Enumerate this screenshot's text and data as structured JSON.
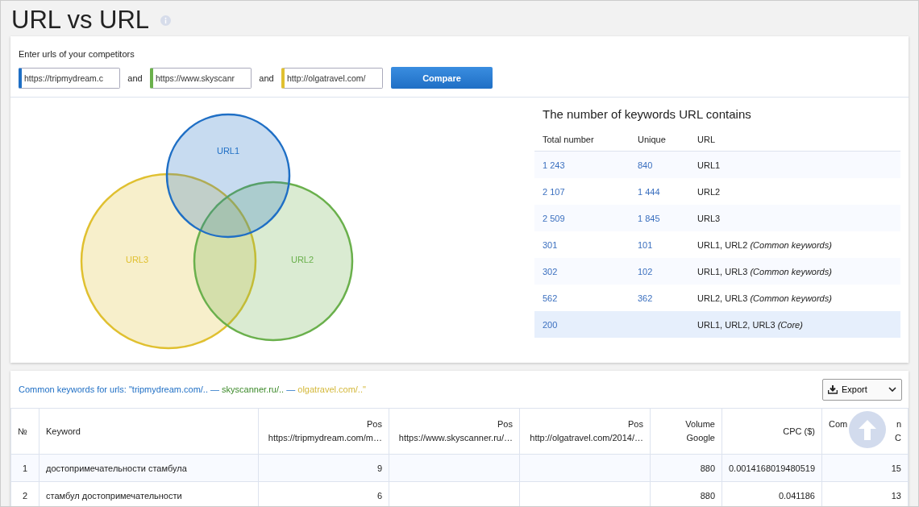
{
  "title": "URL vs URL",
  "form": {
    "label": "Enter urls of your competitors",
    "fields": [
      {
        "value": "https://tripmydream.c",
        "color": "#1f6fc5"
      },
      {
        "value": "https://www.skyscanr",
        "color": "#6ab04c"
      },
      {
        "value": "http://olgatravel.com/",
        "color": "#e0c030"
      }
    ],
    "separators": [
      "and",
      "and"
    ],
    "button": "Compare"
  },
  "venn": {
    "circles": [
      {
        "label": "URL1",
        "color": "#1f6fc5"
      },
      {
        "label": "URL2",
        "color": "#6ab04c"
      },
      {
        "label": "URL3",
        "color": "#e0c030"
      }
    ]
  },
  "stats": {
    "title": "The number of keywords URL contains",
    "columns": [
      "Total number",
      "Unique",
      "URL"
    ],
    "rows": [
      {
        "total": "1 243",
        "unique": "840",
        "url": "URL1",
        "selected": false
      },
      {
        "total": "2 107",
        "unique": "1 444",
        "url": "URL2",
        "selected": false
      },
      {
        "total": "2 509",
        "unique": "1 845",
        "url": "URL3",
        "selected": false
      },
      {
        "total": "301",
        "unique": "101",
        "url": "URL1, URL2 *(Common keywords)*",
        "selected": false
      },
      {
        "total": "302",
        "unique": "102",
        "url": "URL1, URL3 *(Common keywords)*",
        "selected": false
      },
      {
        "total": "562",
        "unique": "362",
        "url": "URL2, URL3 *(Common keywords)*",
        "selected": false
      },
      {
        "total": "200",
        "url": "URL1, URL2, URL3 *(Core)*",
        "selected": true
      }
    ]
  },
  "keywords": {
    "caption": [
      {
        "text": "Common keywords for urls: \""
      },
      {
        "text": "tripmydream.com/..",
        "color": "#1f6fc5"
      },
      {
        "text": " — "
      },
      {
        "text": "skyscanner.ru/..",
        "color": "#3d8a2a"
      },
      {
        "text": " — "
      },
      {
        "text": "olgatravel.com/..\"",
        "color": "#d4b83a"
      }
    ],
    "export_button": "Export",
    "columns": [
      {
        "lines": [
          "№"
        ]
      },
      {
        "lines": [
          "Keyword"
        ]
      },
      {
        "lines": [
          "Pos",
          "https://tripmydream.com/m…"
        ]
      },
      {
        "lines": [
          "Pos",
          "https://www.skyscanner.ru/…"
        ]
      },
      {
        "lines": [
          "Pos",
          "http://olgatravel.com/2014/…"
        ]
      },
      {
        "lines": [
          "Volume",
          "Google"
        ]
      },
      {
        "lines": [
          "CPC ($)"
        ]
      },
      {
        "lines": [
          "Com",
          "n",
          "C"
        ],
        "kind": "covered"
      }
    ],
    "rows": [
      [
        "1",
        "достопримечательности стамбула",
        "9",
        "",
        "",
        "880",
        "0.0014168019480519",
        "15"
      ],
      [
        "2",
        "стамбул достопримечательности",
        "6",
        "",
        "",
        "880",
        "0.041186",
        "13"
      ]
    ]
  }
}
